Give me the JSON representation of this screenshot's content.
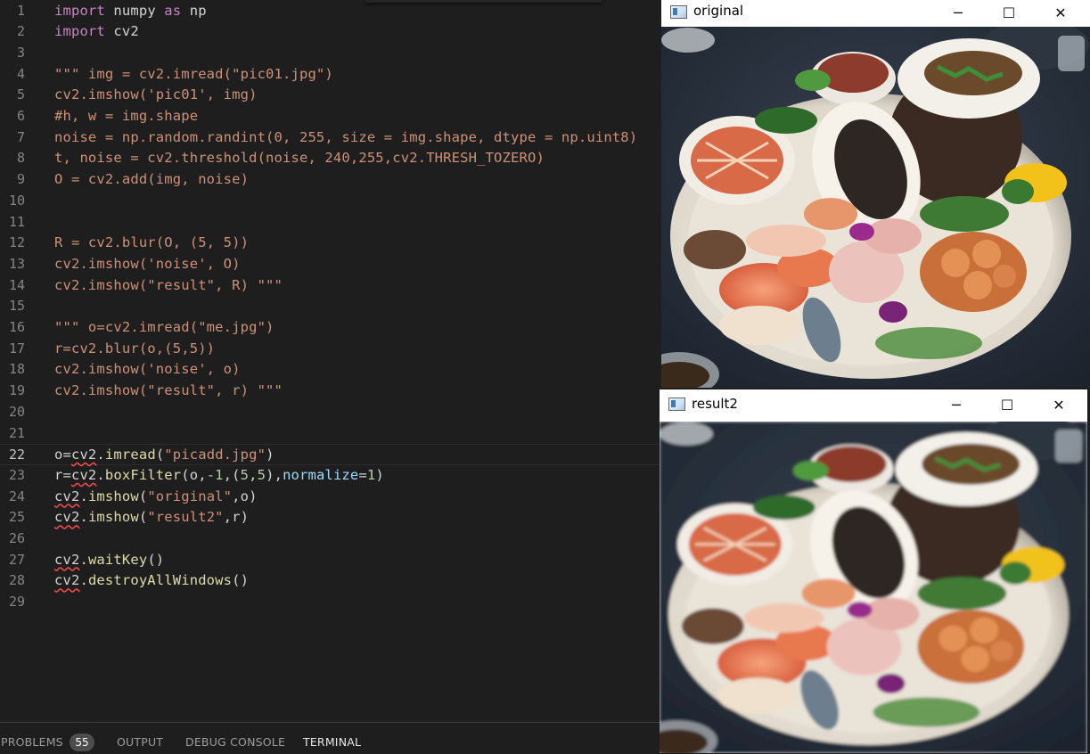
{
  "editor": {
    "lines": [
      {
        "n": "1",
        "t": [
          {
            "c": "kw",
            "v": "import"
          },
          {
            "c": "",
            "v": " numpy "
          },
          {
            "c": "kw",
            "v": "as"
          },
          {
            "c": "",
            "v": " np"
          }
        ]
      },
      {
        "n": "2",
        "t": [
          {
            "c": "kw",
            "v": "import"
          },
          {
            "c": "",
            "v": " cv2"
          }
        ]
      },
      {
        "n": "3",
        "t": []
      },
      {
        "n": "4",
        "t": [
          {
            "c": "cmt",
            "v": "\"\"\" img = cv2.imread(\"pic01.jpg\")"
          }
        ]
      },
      {
        "n": "5",
        "t": [
          {
            "c": "cmt",
            "v": "cv2.imshow('pic01', img)"
          }
        ]
      },
      {
        "n": "6",
        "t": [
          {
            "c": "cmt",
            "v": "#h, w = img.shape"
          }
        ]
      },
      {
        "n": "7",
        "t": [
          {
            "c": "cmt",
            "v": "noise = np.random.randint(0, 255, size = img.shape, dtype = np.uint8)"
          }
        ]
      },
      {
        "n": "8",
        "t": [
          {
            "c": "cmt",
            "v": "t, noise = cv2.threshold(noise, 240,255,cv2.THRESH_TOZERO)"
          }
        ]
      },
      {
        "n": "9",
        "t": [
          {
            "c": "cmt",
            "v": "O = cv2.add(img, noise)"
          }
        ]
      },
      {
        "n": "10",
        "t": []
      },
      {
        "n": "11",
        "t": []
      },
      {
        "n": "12",
        "t": [
          {
            "c": "cmt",
            "v": "R = cv2.blur(O, (5, 5))"
          }
        ]
      },
      {
        "n": "13",
        "t": [
          {
            "c": "cmt",
            "v": "cv2.imshow('noise', O)"
          }
        ]
      },
      {
        "n": "14",
        "t": [
          {
            "c": "cmt",
            "v": "cv2.imshow(\"result\", R) \"\"\""
          }
        ]
      },
      {
        "n": "15",
        "t": []
      },
      {
        "n": "16",
        "t": [
          {
            "c": "cmt",
            "v": "\"\"\" o=cv2.imread(\"me.jpg\")"
          }
        ]
      },
      {
        "n": "17",
        "t": [
          {
            "c": "cmt",
            "v": "r=cv2.blur(o,(5,5))"
          }
        ]
      },
      {
        "n": "18",
        "t": [
          {
            "c": "cmt",
            "v": "cv2.imshow('noise', o)"
          }
        ]
      },
      {
        "n": "19",
        "t": [
          {
            "c": "cmt",
            "v": "cv2.imshow(\"result\", r) \"\"\""
          }
        ]
      },
      {
        "n": "20",
        "t": []
      },
      {
        "n": "21",
        "t": []
      },
      {
        "n": "22",
        "current": true,
        "t": [
          {
            "c": "",
            "v": "o="
          },
          {
            "c": "sq",
            "v": "cv2"
          },
          {
            "c": "",
            "v": "."
          },
          {
            "c": "fn",
            "v": "imread"
          },
          {
            "c": "",
            "v": "("
          },
          {
            "c": "str",
            "v": "\"picadd.jpg\""
          },
          {
            "c": "",
            "v": ")"
          }
        ]
      },
      {
        "n": "23",
        "t": [
          {
            "c": "",
            "v": "r="
          },
          {
            "c": "sq",
            "v": "cv2"
          },
          {
            "c": "",
            "v": "."
          },
          {
            "c": "fn",
            "v": "boxFilter"
          },
          {
            "c": "",
            "v": "(o,"
          },
          {
            "c": "num",
            "v": "-1"
          },
          {
            "c": "",
            "v": ",("
          },
          {
            "c": "num",
            "v": "5"
          },
          {
            "c": "",
            "v": ","
          },
          {
            "c": "num",
            "v": "5"
          },
          {
            "c": "",
            "v": "),"
          },
          {
            "c": "param",
            "v": "normalize"
          },
          {
            "c": "",
            "v": "="
          },
          {
            "c": "num",
            "v": "1"
          },
          {
            "c": "",
            "v": ")"
          }
        ]
      },
      {
        "n": "24",
        "t": [
          {
            "c": "sq",
            "v": "cv2"
          },
          {
            "c": "",
            "v": "."
          },
          {
            "c": "fn",
            "v": "imshow"
          },
          {
            "c": "",
            "v": "("
          },
          {
            "c": "str",
            "v": "\"original\""
          },
          {
            "c": "",
            "v": ",o)"
          }
        ]
      },
      {
        "n": "25",
        "t": [
          {
            "c": "sq",
            "v": "cv2"
          },
          {
            "c": "",
            "v": "."
          },
          {
            "c": "fn",
            "v": "imshow"
          },
          {
            "c": "",
            "v": "("
          },
          {
            "c": "str",
            "v": "\"result2\""
          },
          {
            "c": "",
            "v": ",r)"
          }
        ]
      },
      {
        "n": "26",
        "t": []
      },
      {
        "n": "27",
        "t": [
          {
            "c": "sq",
            "v": "cv2"
          },
          {
            "c": "",
            "v": "."
          },
          {
            "c": "fn",
            "v": "waitKey"
          },
          {
            "c": "",
            "v": "()"
          }
        ]
      },
      {
        "n": "28",
        "t": [
          {
            "c": "sq",
            "v": "cv2"
          },
          {
            "c": "",
            "v": "."
          },
          {
            "c": "fn",
            "v": "destroyAllWindows"
          },
          {
            "c": "",
            "v": "()"
          }
        ]
      },
      {
        "n": "29",
        "t": []
      }
    ]
  },
  "panel": {
    "problems_label": "PROBLEMS",
    "problems_count": "55",
    "output_label": "OUTPUT",
    "debug_label": "DEBUG CONSOLE",
    "terminal_label": "TERMINAL"
  },
  "windows": {
    "original_title": "original",
    "result_title": "result2",
    "minimize": "─",
    "maximize": "☐",
    "close": "✕"
  },
  "colors": {
    "editor_bg": "#1e1e1e",
    "string": "#ce9178",
    "keyword": "#c586c0",
    "function": "#dcdcaa",
    "number": "#b5cea8",
    "error_squiggle": "#f14c4c"
  }
}
